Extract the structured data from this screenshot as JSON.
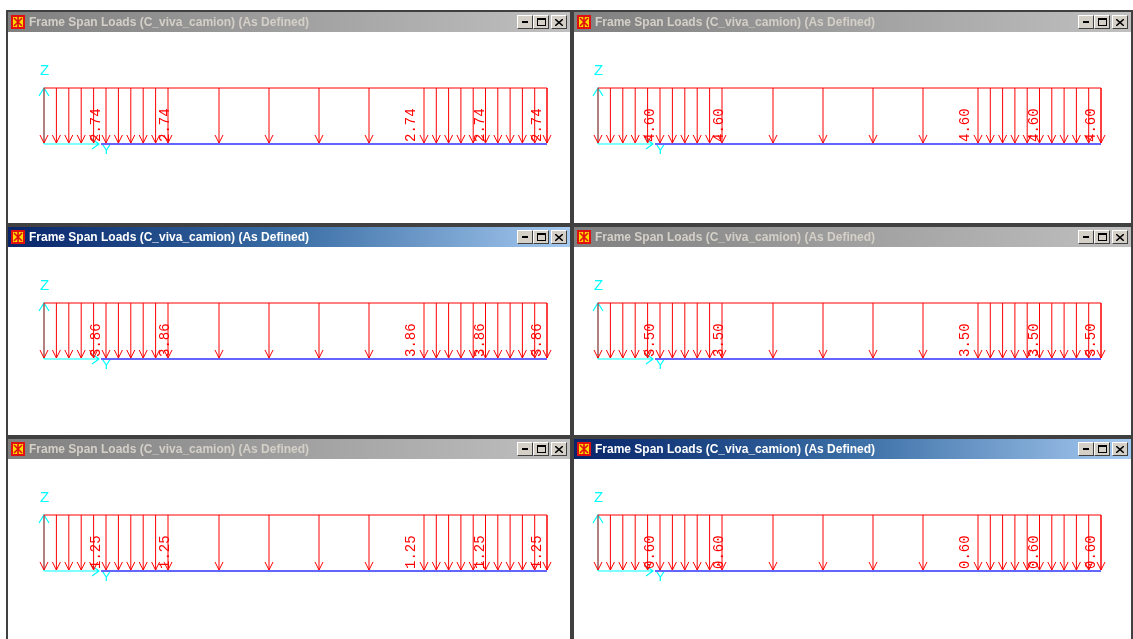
{
  "windows": [
    {
      "title": "Frame Span Loads (C_viva_camion) (As Defined)",
      "active": false,
      "axis_z": "Z",
      "axis_y": "Y",
      "load_labels": [
        "2.74",
        "2.74",
        "2.74",
        "2.74",
        "2.74"
      ]
    },
    {
      "title": "Frame Span Loads (C_viva_camion) (As Defined)",
      "active": false,
      "axis_z": "Z",
      "axis_y": "Y",
      "load_labels": [
        "4.60",
        "4.60",
        "4.60",
        "4.60",
        "4.60"
      ]
    },
    {
      "title": "Frame Span Loads (C_viva_camion) (As Defined)",
      "active": true,
      "axis_z": "Z",
      "axis_y": "Y",
      "load_labels": [
        "3.86",
        "3.86",
        "3.86",
        "3.86",
        "3.86"
      ]
    },
    {
      "title": "Frame Span Loads (C_viva_camion) (As Defined)",
      "active": false,
      "axis_z": "Z",
      "axis_y": "Y",
      "load_labels": [
        "3.50",
        "3.50",
        "3.50",
        "3.50",
        "3.50"
      ]
    },
    {
      "title": "Frame Span Loads (C_viva_camion) (As Defined)",
      "active": false,
      "axis_z": "Z",
      "axis_y": "Y",
      "load_labels": [
        "1.25",
        "1.25",
        "1.25",
        "1.25",
        "1.25"
      ]
    },
    {
      "title": "Frame Span Loads (C_viva_camion) (As Defined)",
      "active": true,
      "axis_z": "Z",
      "axis_y": "Y",
      "load_labels": [
        "0.60",
        "0.60",
        "0.60",
        "0.60",
        "0.60"
      ]
    }
  ]
}
